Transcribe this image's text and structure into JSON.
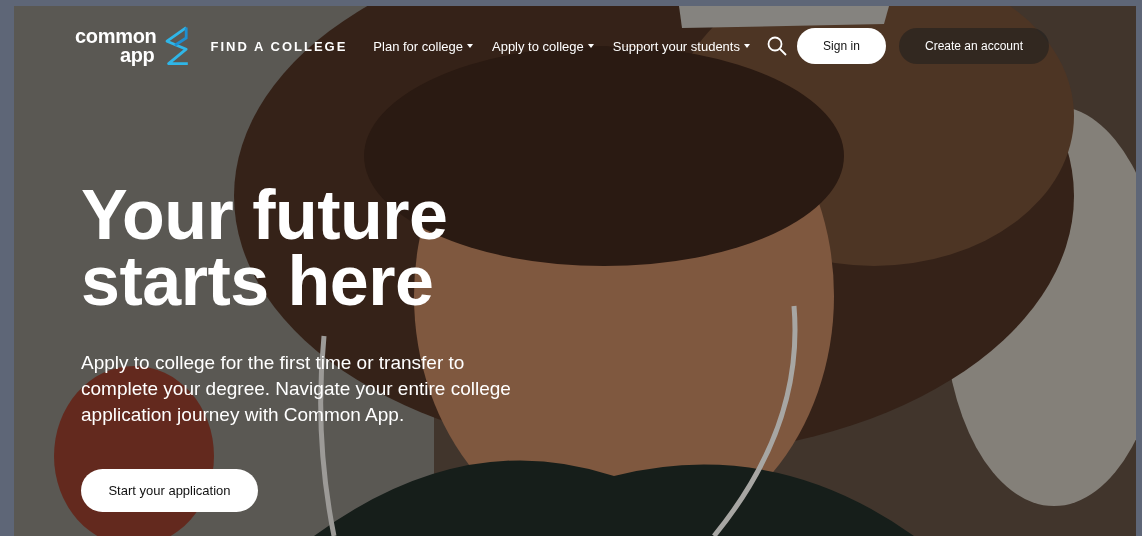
{
  "header": {
    "logo": {
      "line_1": "common",
      "line_2": "app"
    },
    "nav": [
      {
        "label": "FIND A COLLEGE",
        "kind": "link"
      },
      {
        "label": "Plan for college",
        "kind": "dropdown"
      },
      {
        "label": "Apply to college",
        "kind": "dropdown"
      },
      {
        "label": "Support your students",
        "kind": "dropdown"
      }
    ],
    "sign_in": "Sign in",
    "create_account": "Create an account"
  },
  "hero": {
    "title": "Your future starts here",
    "subtitle": "Apply to college for the first time or transfer to complete your degree. Navigate your entire college application journey with Common App.",
    "cta": "Start your application"
  }
}
